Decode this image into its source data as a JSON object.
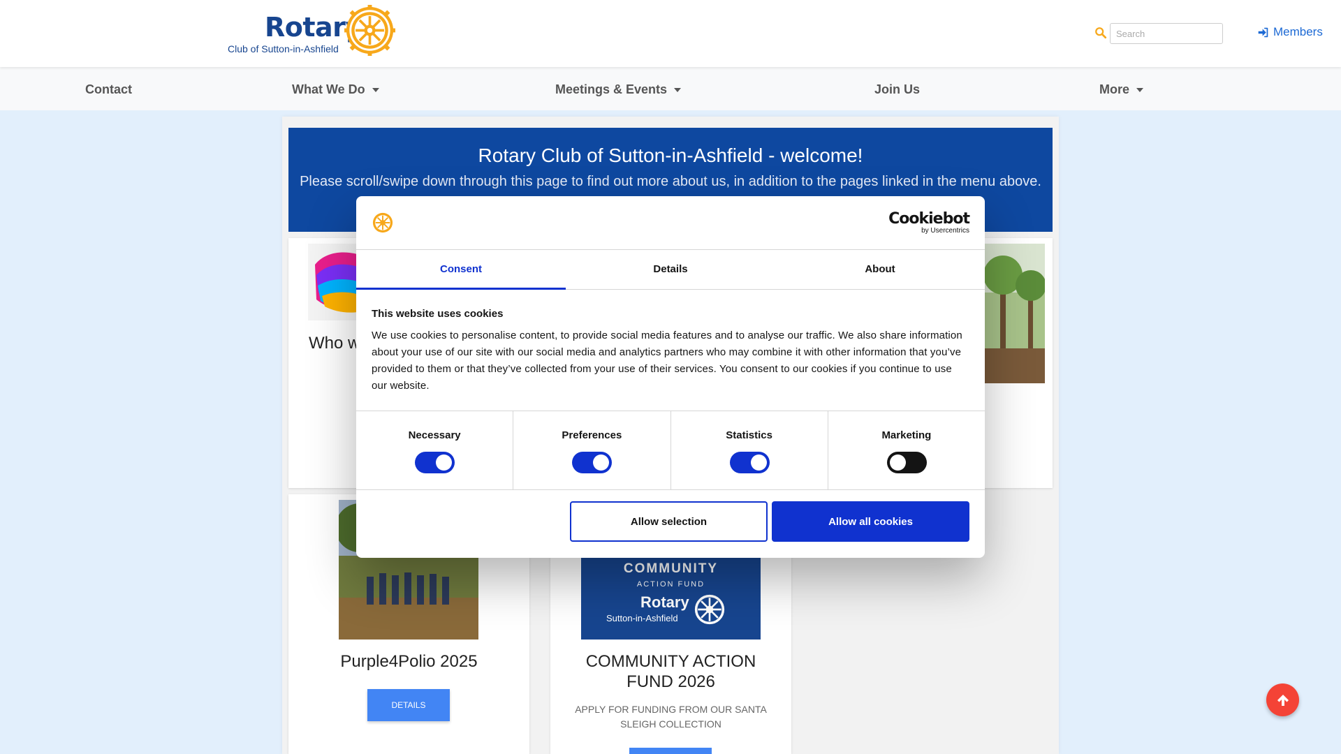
{
  "header": {
    "logo_word": "Rotary",
    "logo_sub": "Club of Sutton-in-Ashfield",
    "search_placeholder": "Search",
    "members_label": "Members"
  },
  "nav": {
    "items": [
      {
        "label": "Contact"
      },
      {
        "label": "What We Do"
      },
      {
        "label": "Meetings & Events"
      },
      {
        "label": "Join Us"
      },
      {
        "label": "More"
      }
    ]
  },
  "welcome": {
    "title": "Rotary Club of Sutton-in-Ashfield - welcome!",
    "subtitle": "Please scroll/swipe down through this page to find out more about us, in addition to the pages linked in the menu above."
  },
  "cards": {
    "who_text": "Who w",
    "purple": {
      "title": "Purple4Polio 2025",
      "button": "DETAILS"
    },
    "community": {
      "title": "COMMUNITY ACTION FUND 2026",
      "description": "APPLY FOR FUNDING FROM OUR SANTA SLEIGH COLLECTION",
      "image_line1": "COMMUNITY",
      "image_line2": "ACTION FUND",
      "image_line3": "Rotary",
      "image_line4": "Sutton-in-Ashfield"
    }
  },
  "cookie_dialog": {
    "brand": "Cookiebot",
    "brand_sub": "by Usercentrics",
    "tabs": [
      {
        "label": "Consent"
      },
      {
        "label": "Details"
      },
      {
        "label": "About"
      }
    ],
    "heading": "This website uses cookies",
    "body": "We use cookies to personalise content, to provide social media features and to analyse our traffic. We also share information about your use of our site with our social media and analytics partners who may combine it with other information that you’ve provided to them or that they’ve collected from your use of their services. You consent to our cookies if you continue to use our website.",
    "toggles": [
      {
        "label": "Necessary",
        "on": true
      },
      {
        "label": "Preferences",
        "on": true
      },
      {
        "label": "Statistics",
        "on": true
      },
      {
        "label": "Marketing",
        "on": false
      }
    ],
    "allow_selection": "Allow selection",
    "allow_all": "Allow all cookies"
  },
  "colors": {
    "rotary_blue": "#17458f",
    "rotary_gold": "#f7a81b",
    "welcome_bg": "#0e48a0",
    "cookiebot_blue": "#1032cf",
    "back_to_top": "#f44336"
  }
}
